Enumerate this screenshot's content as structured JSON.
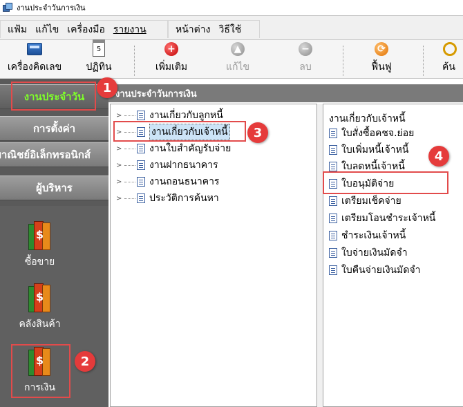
{
  "window": {
    "title": "งานประจำวันการเงิน"
  },
  "menu": [
    {
      "label": "แฟ้ม",
      "underline": false
    },
    {
      "label": "แก้ไข",
      "underline": false
    },
    {
      "label": "เครื่องมือ",
      "underline": false
    },
    {
      "label": "รายงาน",
      "underline": true
    },
    {
      "label": "หน้าต่าง",
      "underline": false
    },
    {
      "label": "วิธีใช้",
      "underline": false
    }
  ],
  "toolbar": {
    "calculator": "เครื่องคิดเลข",
    "calendar": "ปฏิทิน",
    "calendar_day": "5",
    "add": "เพิ่มเติม",
    "edit": "แก้ไข",
    "delete": "ลบ",
    "refresh": "ฟื้นฟู",
    "search": "ค้น"
  },
  "sidebar": {
    "daily": "งานประจำวัน",
    "settings": "การตั้งค่า",
    "ecommerce": "พาณิชย์อิเล็กทรอนิกส์",
    "admin": "ผู้บริหาร",
    "modules": [
      {
        "label": "ซื้อขาย"
      },
      {
        "label": "คลังสินค้า"
      },
      {
        "label": "การเงิน"
      }
    ]
  },
  "panel": {
    "title": "งานประจำวันการเงิน"
  },
  "tree": [
    {
      "label": "งานเกี่ยวกับลูกหนี้"
    },
    {
      "label": "งานเกี่ยวกับเจ้าหนี้"
    },
    {
      "label": "งานใบสำคัญรับจ่าย"
    },
    {
      "label": "งานฝากธนาคาร"
    },
    {
      "label": "งานถอนธนาคาร"
    },
    {
      "label": "ประวัติการค้นหา"
    }
  ],
  "right_list": {
    "heading": "งานเกี่ยวกับเจ้าหนี้",
    "items": [
      {
        "label": "ใบสั่งซื้อคชจ.ย่อย"
      },
      {
        "label": "ใบเพิ่มหนี้เจ้าหนี้"
      },
      {
        "label": "ใบลดหนี้เจ้าหนี้"
      },
      {
        "label": "ใบอนุมัติจ่าย"
      },
      {
        "label": "เตรียมเช็คจ่าย"
      },
      {
        "label": "เตรียมโอนชำระเจ้าหนี้"
      },
      {
        "label": "ชำระเงินเจ้าหนี้"
      },
      {
        "label": "ใบจ่ายเงินมัดจำ"
      },
      {
        "label": "ใบคืนจ่ายเงินมัดจำ"
      }
    ]
  },
  "callouts": [
    "1",
    "2",
    "3",
    "4"
  ],
  "colors": {
    "highlight": "#e24b4b",
    "active_nav_text": "#7fff2a",
    "selection": "#cce4f7"
  }
}
